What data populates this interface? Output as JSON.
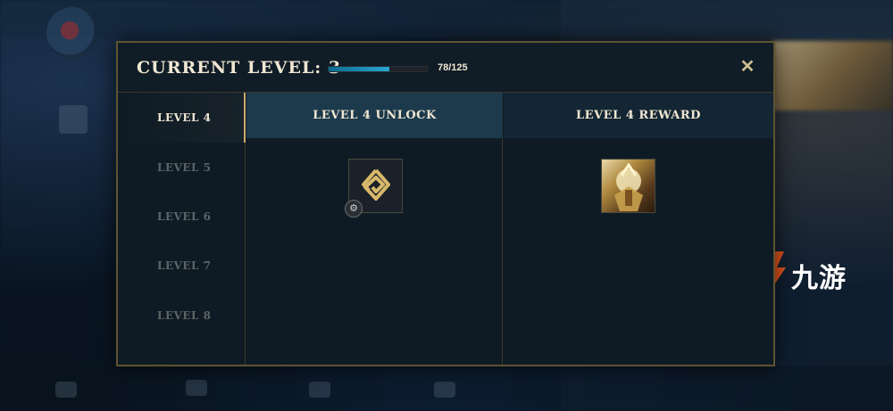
{
  "modal": {
    "title": "CURRENT LEVEL: 3",
    "xp": {
      "current": 78,
      "max": 125,
      "text": "78/125",
      "fill_fraction": 0.62
    },
    "close_icon": "close-icon"
  },
  "levels": [
    {
      "label": "LEVEL 4",
      "active": true
    },
    {
      "label": "LEVEL 5",
      "active": false
    },
    {
      "label": "LEVEL 6",
      "active": false
    },
    {
      "label": "LEVEL 7",
      "active": false
    },
    {
      "label": "LEVEL 8",
      "active": false
    }
  ],
  "columns": {
    "unlock_header": "LEVEL 4 UNLOCK",
    "reward_header": "LEVEL 4 REWARD",
    "unlock_icon": "rune-diamond-icon",
    "reward_icon": "champion-portrait-icon"
  },
  "watermark": {
    "text": "九游"
  },
  "colors": {
    "gold": "#c8aa6e",
    "title": "#f0e6d2",
    "xp_fill": "#2aa7d0",
    "header_bg": "#1c3a4c"
  }
}
